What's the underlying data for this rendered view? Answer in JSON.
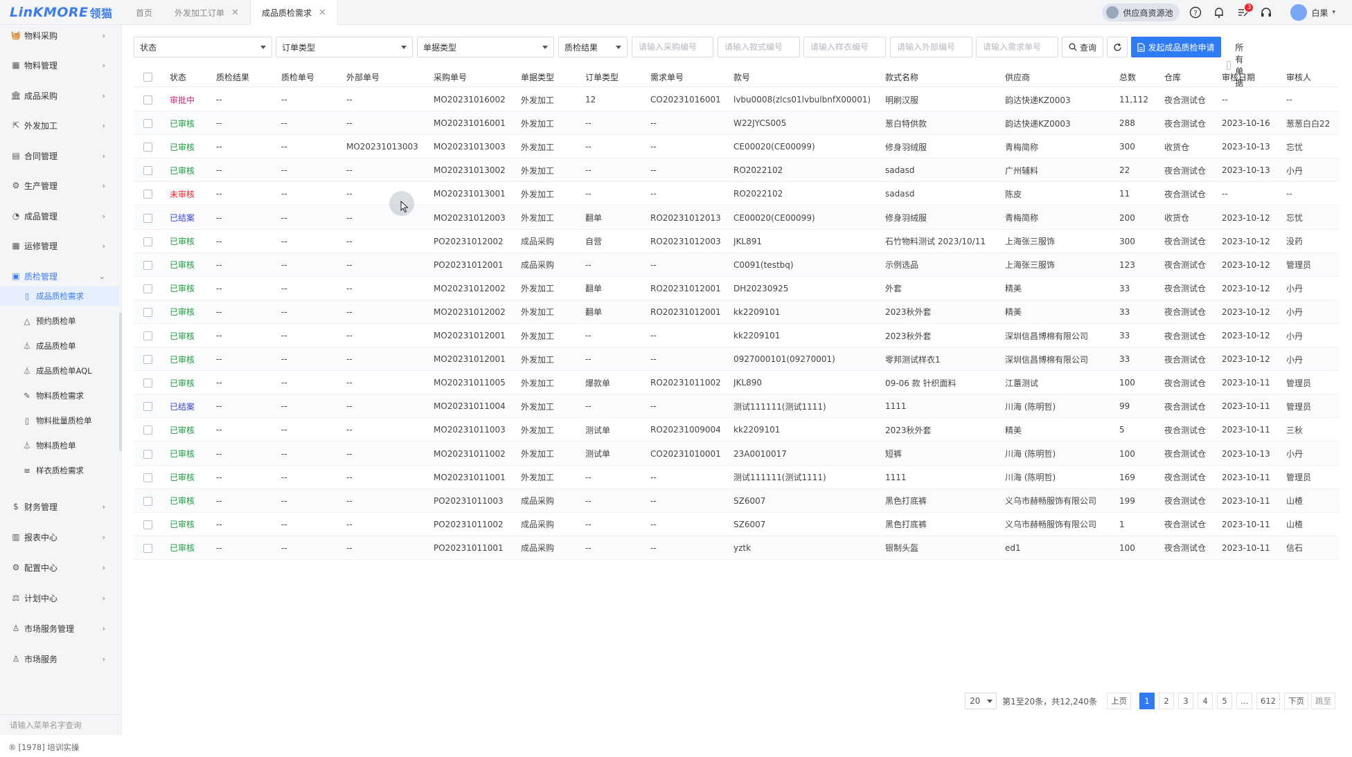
{
  "app": {
    "logo_en": "LinKMORE",
    "logo_cn": "领猫",
    "tabs": [
      {
        "label": "首页",
        "closable": false,
        "active": false
      },
      {
        "label": "外发加工订单",
        "closable": true,
        "active": false
      },
      {
        "label": "成品质检需求",
        "closable": true,
        "active": true
      }
    ],
    "supplier_button": "供应商资源池",
    "notification_badge": "3",
    "user_name": "白果"
  },
  "colors": {
    "primary": "#2f7bf5",
    "approved": "#1a9e3f",
    "pending": "#d4237a",
    "unapproved": "#f5222d",
    "closed": "#3b43d6"
  },
  "sidebar": {
    "items": [
      {
        "label": "物料采购",
        "icon": "basket-icon"
      },
      {
        "label": "物料管理",
        "icon": "boxes-icon"
      },
      {
        "label": "成品采购",
        "icon": "bank-icon"
      },
      {
        "label": "外发加工",
        "icon": "external-link-icon"
      },
      {
        "label": "合同管理",
        "icon": "contract-icon"
      },
      {
        "label": "生产管理",
        "icon": "gears-icon"
      },
      {
        "label": "成品管理",
        "icon": "chart-pie-icon"
      },
      {
        "label": "运修管理",
        "icon": "boxes-icon"
      },
      {
        "label": "质检管理",
        "icon": "qc-icon"
      }
    ],
    "sub_items": [
      {
        "label": "成品质检需求",
        "icon": "doc-icon",
        "active": true
      },
      {
        "label": "预约质检单",
        "icon": "bell-icon"
      },
      {
        "label": "成品质检单",
        "icon": "flask-icon"
      },
      {
        "label": "成品质检单AQL",
        "icon": "flask-icon"
      },
      {
        "label": "物料质检需求",
        "icon": "edit-icon"
      },
      {
        "label": "物料批量质检单",
        "icon": "doc-icon"
      },
      {
        "label": "物料质检单",
        "icon": "flask-icon"
      },
      {
        "label": "样衣质检需求",
        "icon": "doc-list-icon"
      }
    ],
    "bottom_items": [
      {
        "label": "财务管理",
        "icon": "dollar-icon"
      },
      {
        "label": "报表中心",
        "icon": "bar-chart-icon"
      },
      {
        "label": "配置中心",
        "icon": "gears-icon"
      },
      {
        "label": "计划中心",
        "icon": "scale-icon"
      },
      {
        "label": "市场服务管理",
        "icon": "user-icon"
      },
      {
        "label": "市场服务",
        "icon": "user-icon"
      }
    ],
    "search_placeholder": "请输入菜单名字查询",
    "footer": "[1978] 培训实操"
  },
  "filters": {
    "status": "状态",
    "order_type": "订单类型",
    "doc_type": "单据类型",
    "qc_result": "质检结果",
    "ph_purchase_no": "请输入采购编号",
    "ph_style_no": "请输入款式编号",
    "ph_sample_no": "请输入样衣编号",
    "ph_external_no": "请输入外部编号",
    "ph_demand_no": "请输入需求单号",
    "query_label": "查询",
    "create_label": "发起成品质检申请",
    "all_docs_label": "所有单据"
  },
  "table": {
    "headers": [
      "状态",
      "质检结果",
      "质检单号",
      "外部单号",
      "采购单号",
      "单据类型",
      "订单类型",
      "需求单号",
      "款号",
      "款式名称",
      "供应商",
      "总数",
      "仓库",
      "审核日期",
      "审核人"
    ],
    "rows": [
      {
        "status": "审批中",
        "status_kind": "pending",
        "qc_result": "--",
        "qc_no": "--",
        "ext_no": "--",
        "po_no": "MO20231016002",
        "doc_type": "外发加工",
        "order_type": "12",
        "demand_no": "CO20231016001",
        "style_no": "lvbu0008(zlcs01lvbulbnfX00001)",
        "style_name": "明刷汉服",
        "supplier": "韵达快递KZ0003",
        "total": "11,112",
        "warehouse": "夜合测试仓",
        "audit_date": "--",
        "auditor": "--"
      },
      {
        "status": "已审核",
        "status_kind": "approved",
        "qc_result": "--",
        "qc_no": "--",
        "ext_no": "--",
        "po_no": "MO20231016001",
        "doc_type": "外发加工",
        "order_type": "--",
        "demand_no": "--",
        "style_no": "W22JYCS005",
        "style_name": "葱白特供款",
        "supplier": "韵达快递KZ0003",
        "total": "288",
        "warehouse": "夜合测试仓",
        "audit_date": "2023-10-16",
        "auditor": "葱葱白白22"
      },
      {
        "status": "已审核",
        "status_kind": "approved",
        "qc_result": "--",
        "qc_no": "--",
        "ext_no": "MO20231013003",
        "po_no": "MO20231013003",
        "doc_type": "外发加工",
        "order_type": "--",
        "demand_no": "--",
        "style_no": "CE00020(CE00099)",
        "style_name": "修身羽绒服",
        "supplier": "青梅简称",
        "total": "300",
        "warehouse": "收货仓",
        "audit_date": "2023-10-13",
        "auditor": "忘忧"
      },
      {
        "status": "已审核",
        "status_kind": "approved",
        "qc_result": "--",
        "qc_no": "--",
        "ext_no": "--",
        "po_no": "MO20231013002",
        "doc_type": "外发加工",
        "order_type": "--",
        "demand_no": "--",
        "style_no": "RO2022102",
        "style_name": "sadasd",
        "supplier": "广州辅料",
        "total": "22",
        "warehouse": "夜合测试仓",
        "audit_date": "2023-10-13",
        "auditor": "小丹"
      },
      {
        "status": "未审核",
        "status_kind": "unapproved",
        "qc_result": "--",
        "qc_no": "--",
        "ext_no": "--",
        "po_no": "MO20231013001",
        "doc_type": "外发加工",
        "order_type": "--",
        "demand_no": "--",
        "style_no": "RO2022102",
        "style_name": "sadasd",
        "supplier": "陈皮",
        "total": "11",
        "warehouse": "夜合测试仓",
        "audit_date": "--",
        "auditor": "--"
      },
      {
        "status": "已结案",
        "status_kind": "closed",
        "qc_result": "--",
        "qc_no": "--",
        "ext_no": "--",
        "po_no": "MO20231012003",
        "doc_type": "外发加工",
        "order_type": "翻单",
        "demand_no": "RO20231012013",
        "style_no": "CE00020(CE00099)",
        "style_name": "修身羽绒服",
        "supplier": "青梅简称",
        "total": "200",
        "warehouse": "收货仓",
        "audit_date": "2023-10-12",
        "auditor": "忘忧"
      },
      {
        "status": "已审核",
        "status_kind": "approved",
        "qc_result": "--",
        "qc_no": "--",
        "ext_no": "--",
        "po_no": "PO20231012002",
        "doc_type": "成品采购",
        "order_type": "自营",
        "demand_no": "RO20231012003",
        "style_no": "JKL891",
        "style_name": "石竹物料测试 2023/10/11",
        "supplier": "上海张三服饰",
        "total": "300",
        "warehouse": "夜合测试仓",
        "audit_date": "2023-10-12",
        "auditor": "没药"
      },
      {
        "status": "已审核",
        "status_kind": "approved",
        "qc_result": "--",
        "qc_no": "--",
        "ext_no": "--",
        "po_no": "PO20231012001",
        "doc_type": "成品采购",
        "order_type": "--",
        "demand_no": "--",
        "style_no": "C0091(testbq)",
        "style_name": "示例选品",
        "supplier": "上海张三服饰",
        "total": "123",
        "warehouse": "夜合测试仓",
        "audit_date": "2023-10-12",
        "auditor": "管理员"
      },
      {
        "status": "已审核",
        "status_kind": "approved",
        "qc_result": "--",
        "qc_no": "--",
        "ext_no": "--",
        "po_no": "MO20231012002",
        "doc_type": "外发加工",
        "order_type": "翻单",
        "demand_no": "RO20231012001",
        "style_no": "DH20230925",
        "style_name": "外套",
        "supplier": "精美",
        "total": "33",
        "warehouse": "夜合测试仓",
        "audit_date": "2023-10-12",
        "auditor": "小丹"
      },
      {
        "status": "已审核",
        "status_kind": "approved",
        "qc_result": "--",
        "qc_no": "--",
        "ext_no": "--",
        "po_no": "MO20231012002",
        "doc_type": "外发加工",
        "order_type": "翻单",
        "demand_no": "RO20231012001",
        "style_no": "kk2209101",
        "style_name": "2023秋外套",
        "supplier": "精美",
        "total": "33",
        "warehouse": "夜合测试仓",
        "audit_date": "2023-10-12",
        "auditor": "小丹"
      },
      {
        "status": "已审核",
        "status_kind": "approved",
        "qc_result": "--",
        "qc_no": "--",
        "ext_no": "--",
        "po_no": "MO20231012001",
        "doc_type": "外发加工",
        "order_type": "--",
        "demand_no": "--",
        "style_no": "kk2209101",
        "style_name": "2023秋外套",
        "supplier": "深圳信昌博棉有限公司",
        "total": "33",
        "warehouse": "夜合测试仓",
        "audit_date": "2023-10-12",
        "auditor": "小丹"
      },
      {
        "status": "已审核",
        "status_kind": "approved",
        "qc_result": "--",
        "qc_no": "--",
        "ext_no": "--",
        "po_no": "MO20231012001",
        "doc_type": "外发加工",
        "order_type": "--",
        "demand_no": "--",
        "style_no": "0927000101(09270001)",
        "style_name": "零邦测试样衣1",
        "supplier": "深圳信昌博棉有限公司",
        "total": "33",
        "warehouse": "夜合测试仓",
        "audit_date": "2023-10-12",
        "auditor": "小丹"
      },
      {
        "status": "已审核",
        "status_kind": "approved",
        "qc_result": "--",
        "qc_no": "--",
        "ext_no": "--",
        "po_no": "MO20231011005",
        "doc_type": "外发加工",
        "order_type": "爆款单",
        "demand_no": "RO20231011002",
        "style_no": "JKL890",
        "style_name": "09-06 款 针织面料",
        "supplier": "江蕙测试",
        "total": "100",
        "warehouse": "夜合测试仓",
        "audit_date": "2023-10-11",
        "auditor": "管理员"
      },
      {
        "status": "已结案",
        "status_kind": "closed",
        "qc_result": "--",
        "qc_no": "--",
        "ext_no": "--",
        "po_no": "MO20231011004",
        "doc_type": "外发加工",
        "order_type": "--",
        "demand_no": "--",
        "style_no": "测试111111(测试1111)",
        "style_name": "1111",
        "supplier": "川海 (陈明哲)",
        "total": "99",
        "warehouse": "夜合测试仓",
        "audit_date": "2023-10-11",
        "auditor": "管理员"
      },
      {
        "status": "已审核",
        "status_kind": "approved",
        "qc_result": "--",
        "qc_no": "--",
        "ext_no": "--",
        "po_no": "MO20231011003",
        "doc_type": "外发加工",
        "order_type": "测试单",
        "demand_no": "RO20231009004",
        "style_no": "kk2209101",
        "style_name": "2023秋外套",
        "supplier": "精美",
        "total": "5",
        "warehouse": "夜合测试仓",
        "audit_date": "2023-10-11",
        "auditor": "三秋"
      },
      {
        "status": "已审核",
        "status_kind": "approved",
        "qc_result": "--",
        "qc_no": "--",
        "ext_no": "--",
        "po_no": "MO20231011002",
        "doc_type": "外发加工",
        "order_type": "测试单",
        "demand_no": "CO20231010001",
        "style_no": "23A0010017",
        "style_name": "短裤",
        "supplier": "川海 (陈明哲)",
        "total": "100",
        "warehouse": "夜合测试仓",
        "audit_date": "2023-10-13",
        "auditor": "小丹"
      },
      {
        "status": "已审核",
        "status_kind": "approved",
        "qc_result": "--",
        "qc_no": "--",
        "ext_no": "--",
        "po_no": "MO20231011001",
        "doc_type": "外发加工",
        "order_type": "--",
        "demand_no": "--",
        "style_no": "测试111111(测试1111)",
        "style_name": "1111",
        "supplier": "川海 (陈明哲)",
        "total": "169",
        "warehouse": "夜合测试仓",
        "audit_date": "2023-10-11",
        "auditor": "管理员"
      },
      {
        "status": "已审核",
        "status_kind": "approved",
        "qc_result": "--",
        "qc_no": "--",
        "ext_no": "--",
        "po_no": "PO20231011003",
        "doc_type": "成品采购",
        "order_type": "--",
        "demand_no": "--",
        "style_no": "SZ6007",
        "style_name": "黑色打底裤",
        "supplier": "义乌市赫畅服饰有限公司",
        "total": "199",
        "warehouse": "夜合测试仓",
        "audit_date": "2023-10-11",
        "auditor": "山楂"
      },
      {
        "status": "已审核",
        "status_kind": "approved",
        "qc_result": "--",
        "qc_no": "--",
        "ext_no": "--",
        "po_no": "PO20231011002",
        "doc_type": "成品采购",
        "order_type": "--",
        "demand_no": "--",
        "style_no": "SZ6007",
        "style_name": "黑色打底裤",
        "supplier": "义乌市赫畅服饰有限公司",
        "total": "1",
        "warehouse": "夜合测试仓",
        "audit_date": "2023-10-11",
        "auditor": "山楂"
      },
      {
        "status": "已审核",
        "status_kind": "approved",
        "qc_result": "--",
        "qc_no": "--",
        "ext_no": "--",
        "po_no": "PO20231011001",
        "doc_type": "成品采购",
        "order_type": "--",
        "demand_no": "--",
        "style_no": "yztk",
        "style_name": "银制头盔",
        "supplier": "ed1",
        "total": "100",
        "warehouse": "夜合测试仓",
        "audit_date": "2023-10-11",
        "auditor": "信石"
      }
    ]
  },
  "pagination": {
    "page_size": "20",
    "summary": "第1至20条，共12,240条",
    "prev": "上页",
    "pages": [
      "1",
      "2",
      "3",
      "4",
      "5",
      "...",
      "612"
    ],
    "current": "1",
    "next": "下页",
    "jump": "跳至"
  }
}
